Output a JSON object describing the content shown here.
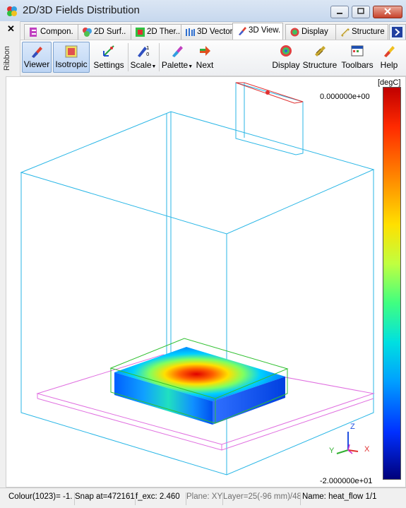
{
  "window": {
    "title": "2D/3D Fields Distribution"
  },
  "ribbon": {
    "label": "Ribbon",
    "close_glyph": "✕"
  },
  "tabs": [
    {
      "label": "Compon.",
      "icon": "component-icon"
    },
    {
      "label": "2D Surf..",
      "icon": "surface-icon"
    },
    {
      "label": "2D Ther..",
      "icon": "thermal-icon"
    },
    {
      "label": "3D Vector",
      "icon": "vector-icon"
    },
    {
      "label": "3D View.",
      "icon": "view3d-icon",
      "active": true
    },
    {
      "label": "Display",
      "icon": "display-icon"
    },
    {
      "label": "Structure",
      "icon": "structure-icon"
    }
  ],
  "toolbar": {
    "viewer": "Viewer",
    "isotropic": "Isotropic",
    "settings": "Settings",
    "scale": "Scale",
    "palette": "Palette",
    "next": "Next",
    "display": "Display",
    "structure": "Structure",
    "toolbars": "Toolbars",
    "help": "Help"
  },
  "view": {
    "unit": "[degC]",
    "colorbar_max": "0.000000e+00",
    "colorbar_min": "-2.000000e+01",
    "axes": {
      "x": "X",
      "y": "Y",
      "z": "Z"
    }
  },
  "status": {
    "colour": "Colour(1023)= -1.",
    "snap": "Snap at=472161",
    "fexc": "f_exc:  2.460",
    "plane": "Plane: XY",
    "layer": "Layer=25(-96 mm)/48",
    "name": "Name: heat_flow 1/1"
  }
}
